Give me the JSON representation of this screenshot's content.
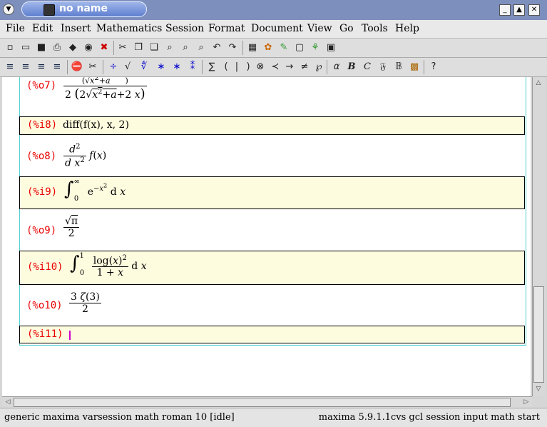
{
  "window": {
    "title": "no name"
  },
  "menu": [
    "File",
    "Edit",
    "Insert",
    "Mathematics",
    "Session",
    "Format",
    "Document",
    "View",
    "Go",
    "Tools",
    "Help"
  ],
  "cells": [
    {
      "label": "(%o7)",
      "kind": "output"
    },
    {
      "label": "(%i8)",
      "kind": "input",
      "text": "diff(f(x), x, 2)"
    },
    {
      "label": "(%o8)",
      "kind": "output"
    },
    {
      "label": "(%i9)",
      "kind": "input"
    },
    {
      "label": "(%o9)",
      "kind": "output"
    },
    {
      "label": "(%i10)",
      "kind": "input"
    },
    {
      "label": "(%o10)",
      "kind": "output"
    },
    {
      "label": "(%i11)",
      "kind": "input",
      "text": ""
    }
  ],
  "status": {
    "left": "generic maxima varsession math roman 10 [idle]",
    "right": "maxima 5.9.1.1cvs gcl session input math start"
  },
  "colors": {
    "label_red": "#e80000",
    "input_bg": "#fefcdf",
    "title_bg": "#7d8fbd"
  }
}
